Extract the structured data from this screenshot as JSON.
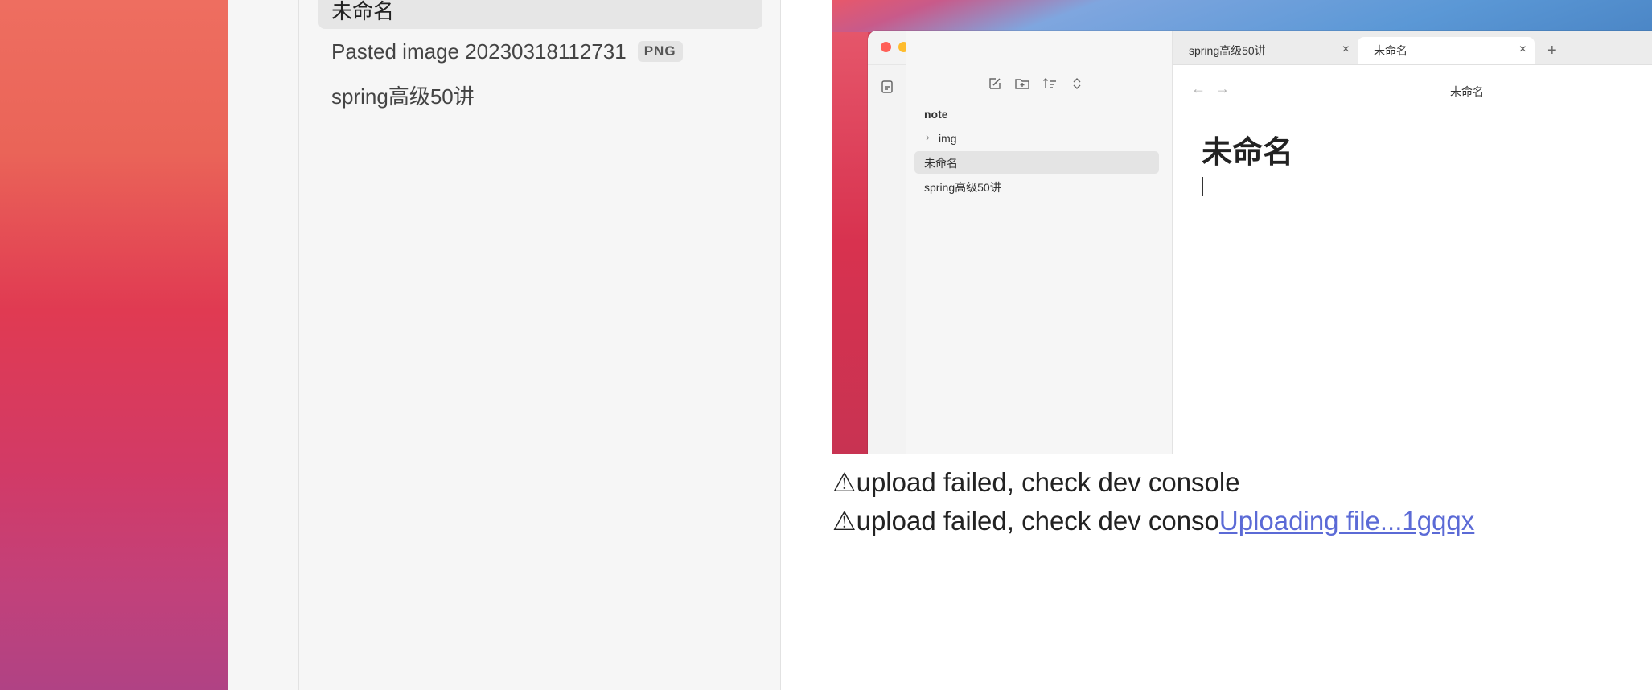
{
  "filelist": {
    "items": [
      {
        "label": "未命名",
        "badge": ""
      },
      {
        "label": "Pasted image 20230318112731",
        "badge": "PNG"
      },
      {
        "label": "spring高级50讲",
        "badge": ""
      }
    ]
  },
  "embedded_app": {
    "tabs": [
      {
        "label": "spring高级50讲"
      },
      {
        "label": "未命名"
      }
    ],
    "tree": {
      "root": "note",
      "items": [
        "img",
        "未命名",
        "spring高级50讲"
      ]
    },
    "header_title": "未命名",
    "doc_title": "未命名"
  },
  "editor": {
    "error_line_1": "upload failed, check dev console",
    "error_line_2_text": "upload failed, check dev conso",
    "error_line_2_link": "Uploading file...1gqqx",
    "warn_glyph": "⚠"
  },
  "icons": {
    "close": "×",
    "plus": "+",
    "chevron": "›",
    "back": "←",
    "forward": "→"
  },
  "colors": {
    "link": "#5b6ad6",
    "traffic_red": "#ff5f57",
    "traffic_yellow": "#febc2e",
    "traffic_green": "#28c840"
  }
}
